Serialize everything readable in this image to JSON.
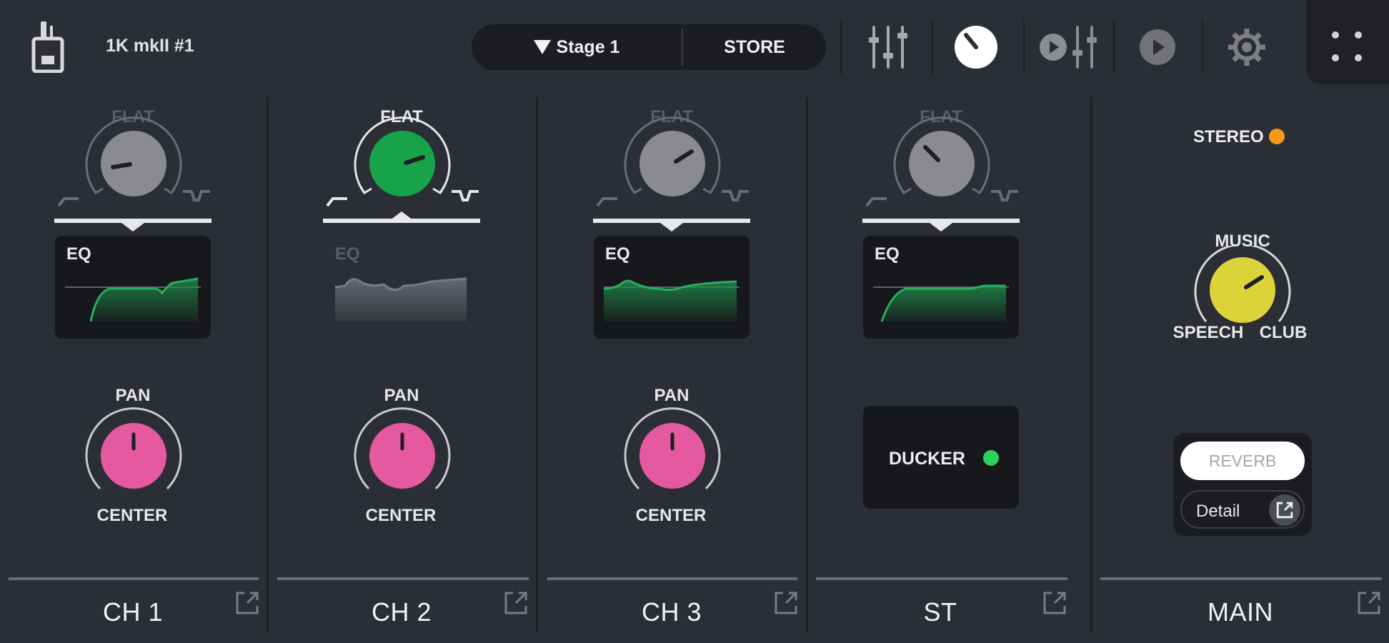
{
  "header": {
    "device_name": "1K mkII #1",
    "scene_label": "Stage 1",
    "store_label": "STORE",
    "icons": [
      "device-icon",
      "mixer-faders-icon",
      "knob-icon",
      "player-faders-icon",
      "play-icon",
      "gear-icon",
      "grid-dots-icon"
    ]
  },
  "strips": [
    {
      "label": "CH 1",
      "flat_label": "FLAT",
      "eq_label": "EQ",
      "pan_label": "PAN",
      "pan_value": "CENTER"
    },
    {
      "label": "CH 2",
      "flat_label": "FLAT",
      "eq_label": "EQ",
      "pan_label": "PAN",
      "pan_value": "CENTER"
    },
    {
      "label": "CH 3",
      "flat_label": "FLAT",
      "eq_label": "EQ",
      "pan_label": "PAN",
      "pan_value": "CENTER"
    },
    {
      "label": "ST",
      "flat_label": "FLAT",
      "eq_label": "EQ",
      "ducker_label": "DUCKER"
    }
  ],
  "main": {
    "label": "MAIN",
    "stereo_label": "STEREO",
    "music_label": "MUSIC",
    "speech_label": "SPEECH",
    "club_label": "CLUB",
    "reverb_label": "REVERB",
    "detail_label": "Detail"
  },
  "colors": {
    "background": "#2c2e35",
    "knob_gray": "#8a8b8f",
    "knob_green": "#16a34a",
    "knob_pink": "#e559a0",
    "knob_yellow": "#dcd33a",
    "eq_green": "#1f8a4a",
    "stereo_indicator": "#f39a1c",
    "ducker_indicator": "#2bd35a"
  }
}
